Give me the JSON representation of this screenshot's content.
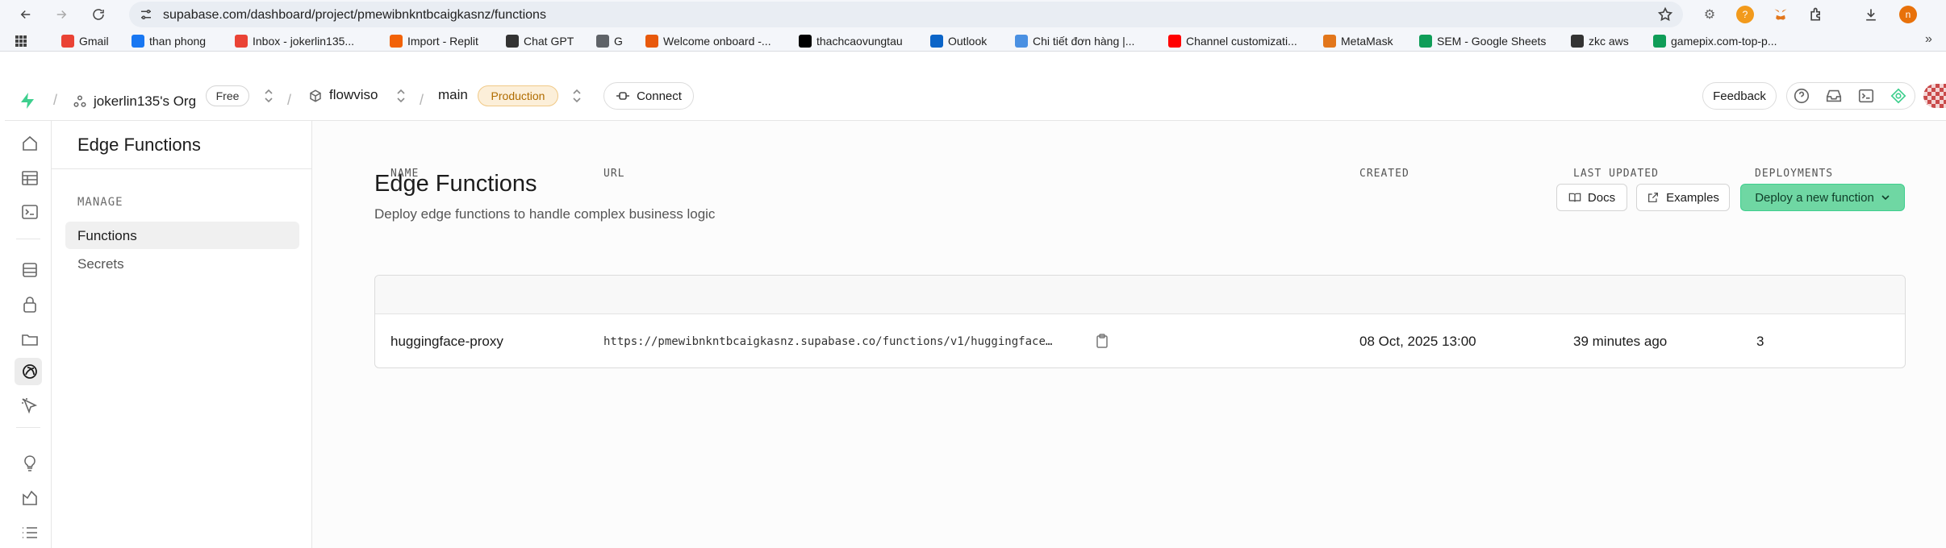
{
  "browser": {
    "url": "supabase.com/dashboard/project/pmewibnkntbcaigkasnz/functions",
    "profile_initial": "n",
    "bookmarks": [
      {
        "label": "Gmail",
        "icon": "gmail-icon",
        "color": "#ea4335"
      },
      {
        "label": "than phong",
        "icon": "facebook-icon",
        "color": "#1877f2"
      },
      {
        "label": "Inbox - jokerlin135...",
        "icon": "gmail-icon",
        "color": "#ea4335"
      },
      {
        "label": "Import - Replit",
        "icon": "replit-icon",
        "color": "#f26207"
      },
      {
        "label": "Chat GPT",
        "icon": "openai-icon",
        "color": "#333333"
      },
      {
        "label": "G",
        "icon": "folder-icon",
        "color": "#5f6368"
      },
      {
        "label": "Welcome onboard -...",
        "icon": "star-brand-icon",
        "color": "#e8590c"
      },
      {
        "label": "thachcaovungtau",
        "icon": "x-icon",
        "color": "#000000"
      },
      {
        "label": "Outlook",
        "icon": "outlook-icon",
        "color": "#0a64c8"
      },
      {
        "label": "Chi tiết đơn hàng |...",
        "icon": "order-icon",
        "color": "#4a90e2"
      },
      {
        "label": "Channel customizati...",
        "icon": "youtube-icon",
        "color": "#ff0000"
      },
      {
        "label": "MetaMask",
        "icon": "metamask-icon",
        "color": "#e2761b"
      },
      {
        "label": "SEM - Google Sheets",
        "icon": "sheets-icon",
        "color": "#0f9d58"
      },
      {
        "label": "zkc aws",
        "icon": "globe-icon",
        "color": "#333333"
      },
      {
        "label": "gamepix.com-top-p...",
        "icon": "sheets-icon",
        "color": "#0f9d58"
      }
    ]
  },
  "header": {
    "org": "jokerlin135's Org",
    "org_plan": "Free",
    "project": "flowviso",
    "branch": "main",
    "environment": "Production",
    "connect_label": "Connect",
    "feedback_label": "Feedback"
  },
  "menu": {
    "title": "Edge Functions",
    "section": "MANAGE",
    "items": [
      {
        "label": "Functions",
        "active": true
      },
      {
        "label": "Secrets",
        "active": false
      }
    ]
  },
  "page": {
    "title": "Edge Functions",
    "subtitle": "Deploy edge functions to handle complex business logic",
    "docs_label": "Docs",
    "examples_label": "Examples",
    "deploy_label": "Deploy a new function"
  },
  "table": {
    "columns": [
      "NAME",
      "URL",
      "CREATED",
      "LAST UPDATED",
      "DEPLOYMENTS"
    ],
    "rows": [
      {
        "name": "huggingface-proxy",
        "url": "https://pmewibnkntbcaigkasnz.supabase.co/functions/v1/huggingface…",
        "created": "08 Oct, 2025 13:00",
        "last_updated": "39 minutes ago",
        "deployments": "3"
      }
    ]
  },
  "colors": {
    "brand_green": "#3ecf8e",
    "deploy_bg": "#6fd7a3",
    "production_bg": "#fcefd9",
    "production_text": "#b06c00"
  }
}
